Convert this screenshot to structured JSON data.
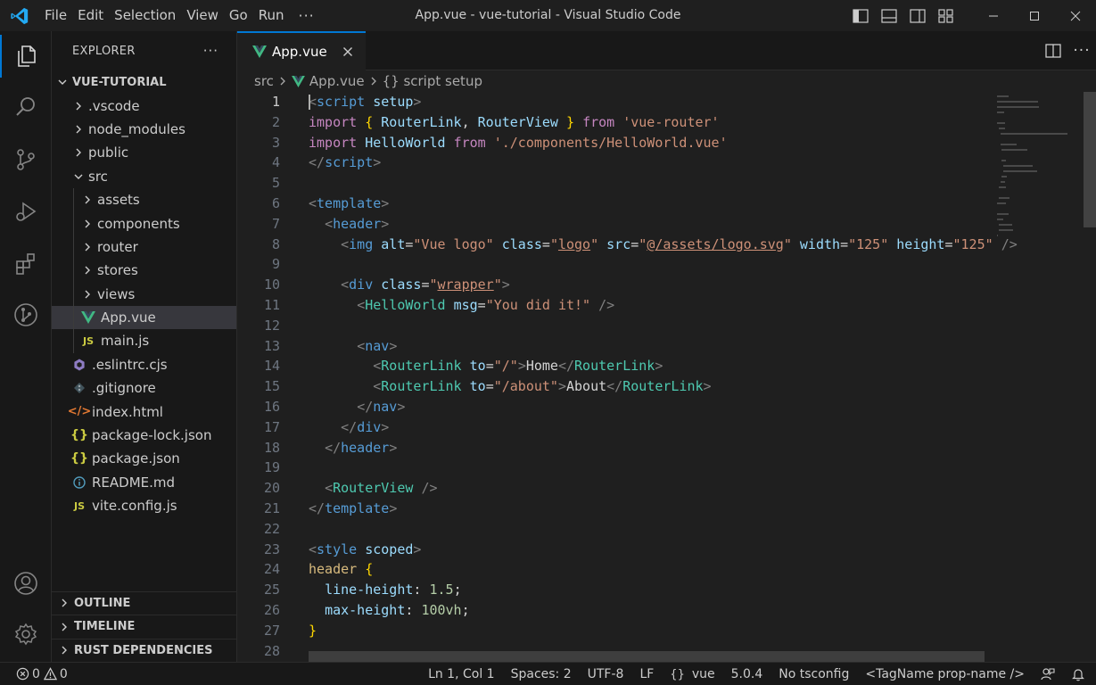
{
  "window": {
    "title": "App.vue - vue-tutorial - Visual Studio Code"
  },
  "menu": [
    "File",
    "Edit",
    "Selection",
    "View",
    "Go",
    "Run",
    "···"
  ],
  "activity_bar": {
    "top": [
      "explorer-icon",
      "search-icon",
      "source-control-icon",
      "run-debug-icon",
      "extensions-icon",
      "git-graph-icon"
    ],
    "bottom": [
      "account-icon",
      "settings-gear-icon"
    ]
  },
  "sidebar": {
    "title": "EXPLORER",
    "more": "···",
    "root": "VUE-TUTORIAL",
    "items": [
      {
        "label": ".vscode",
        "kind": "folder",
        "depth": 1,
        "expanded": false
      },
      {
        "label": "node_modules",
        "kind": "folder",
        "depth": 1,
        "expanded": false
      },
      {
        "label": "public",
        "kind": "folder",
        "depth": 1,
        "expanded": false
      },
      {
        "label": "src",
        "kind": "folder",
        "depth": 1,
        "expanded": true
      },
      {
        "label": "assets",
        "kind": "folder",
        "depth": 2,
        "expanded": false
      },
      {
        "label": "components",
        "kind": "folder",
        "depth": 2,
        "expanded": false
      },
      {
        "label": "router",
        "kind": "folder",
        "depth": 2,
        "expanded": false
      },
      {
        "label": "stores",
        "kind": "folder",
        "depth": 2,
        "expanded": false
      },
      {
        "label": "views",
        "kind": "folder",
        "depth": 2,
        "expanded": false
      },
      {
        "label": "App.vue",
        "kind": "vue",
        "depth": 2,
        "selected": true
      },
      {
        "label": "main.js",
        "kind": "js",
        "depth": 2
      },
      {
        "label": ".eslintrc.cjs",
        "kind": "eslint",
        "depth": 1
      },
      {
        "label": ".gitignore",
        "kind": "git",
        "depth": 1
      },
      {
        "label": "index.html",
        "kind": "html",
        "depth": 1
      },
      {
        "label": "package-lock.json",
        "kind": "json",
        "depth": 1
      },
      {
        "label": "package.json",
        "kind": "json",
        "depth": 1
      },
      {
        "label": "README.md",
        "kind": "info",
        "depth": 1
      },
      {
        "label": "vite.config.js",
        "kind": "js",
        "depth": 1
      }
    ],
    "panels": [
      "OUTLINE",
      "TIMELINE",
      "RUST DEPENDENCIES"
    ]
  },
  "editor": {
    "tab": {
      "label": "App.vue",
      "close": "✕"
    },
    "breadcrumb": [
      "src",
      "App.vue",
      "{} script setup"
    ],
    "current_line": 1,
    "lines": [
      [
        [
          "punc",
          "<"
        ],
        [
          "tag",
          "script"
        ],
        [
          "text",
          " "
        ],
        [
          "attr",
          "setup"
        ],
        [
          "punc",
          ">"
        ]
      ],
      [
        [
          "kw",
          "import"
        ],
        [
          "text",
          " "
        ],
        [
          "brace",
          "{"
        ],
        [
          "text",
          " "
        ],
        [
          "var",
          "RouterLink"
        ],
        [
          "text",
          ", "
        ],
        [
          "var",
          "RouterView"
        ],
        [
          "text",
          " "
        ],
        [
          "brace",
          "}"
        ],
        [
          "text",
          " "
        ],
        [
          "kw",
          "from"
        ],
        [
          "text",
          " "
        ],
        [
          "str",
          "'vue-router'"
        ]
      ],
      [
        [
          "kw",
          "import"
        ],
        [
          "text",
          " "
        ],
        [
          "var",
          "HelloWorld"
        ],
        [
          "text",
          " "
        ],
        [
          "kw",
          "from"
        ],
        [
          "text",
          " "
        ],
        [
          "str",
          "'./components/HelloWorld.vue'"
        ]
      ],
      [
        [
          "punc",
          "</"
        ],
        [
          "tag",
          "script"
        ],
        [
          "punc",
          ">"
        ]
      ],
      [],
      [
        [
          "punc",
          "<"
        ],
        [
          "tag",
          "template"
        ],
        [
          "punc",
          ">"
        ]
      ],
      [
        [
          "text",
          "  "
        ],
        [
          "punc",
          "<"
        ],
        [
          "tag",
          "header"
        ],
        [
          "punc",
          ">"
        ]
      ],
      [
        [
          "text",
          "    "
        ],
        [
          "punc",
          "<"
        ],
        [
          "tag",
          "img"
        ],
        [
          "text",
          " "
        ],
        [
          "attr",
          "alt"
        ],
        [
          "text",
          "="
        ],
        [
          "str",
          "\"Vue logo\""
        ],
        [
          "text",
          " "
        ],
        [
          "attr",
          "class"
        ],
        [
          "text",
          "="
        ],
        [
          "str",
          "\""
        ],
        [
          "strU",
          "logo"
        ],
        [
          "str",
          "\""
        ],
        [
          "text",
          " "
        ],
        [
          "attr",
          "src"
        ],
        [
          "text",
          "="
        ],
        [
          "str",
          "\""
        ],
        [
          "strU",
          "@/assets/logo.svg"
        ],
        [
          "str",
          "\""
        ],
        [
          "text",
          " "
        ],
        [
          "attr",
          "width"
        ],
        [
          "text",
          "="
        ],
        [
          "str",
          "\"125\""
        ],
        [
          "text",
          " "
        ],
        [
          "attr",
          "height"
        ],
        [
          "text",
          "="
        ],
        [
          "str",
          "\"125\""
        ],
        [
          "text",
          " "
        ],
        [
          "punc",
          "/>"
        ]
      ],
      [],
      [
        [
          "text",
          "    "
        ],
        [
          "punc",
          "<"
        ],
        [
          "tag",
          "div"
        ],
        [
          "text",
          " "
        ],
        [
          "attr",
          "class"
        ],
        [
          "text",
          "="
        ],
        [
          "str",
          "\""
        ],
        [
          "strU",
          "wrapper"
        ],
        [
          "str",
          "\""
        ],
        [
          "punc",
          ">"
        ]
      ],
      [
        [
          "text",
          "      "
        ],
        [
          "punc",
          "<"
        ],
        [
          "comp",
          "HelloWorld"
        ],
        [
          "text",
          " "
        ],
        [
          "attr",
          "msg"
        ],
        [
          "text",
          "="
        ],
        [
          "str",
          "\"You did it!\""
        ],
        [
          "text",
          " "
        ],
        [
          "punc",
          "/>"
        ]
      ],
      [],
      [
        [
          "text",
          "      "
        ],
        [
          "punc",
          "<"
        ],
        [
          "tag",
          "nav"
        ],
        [
          "punc",
          ">"
        ]
      ],
      [
        [
          "text",
          "        "
        ],
        [
          "punc",
          "<"
        ],
        [
          "comp",
          "RouterLink"
        ],
        [
          "text",
          " "
        ],
        [
          "attr",
          "to"
        ],
        [
          "text",
          "="
        ],
        [
          "str",
          "\"/\""
        ],
        [
          "punc",
          ">"
        ],
        [
          "text",
          "Home"
        ],
        [
          "punc",
          "</"
        ],
        [
          "comp",
          "RouterLink"
        ],
        [
          "punc",
          ">"
        ]
      ],
      [
        [
          "text",
          "        "
        ],
        [
          "punc",
          "<"
        ],
        [
          "comp",
          "RouterLink"
        ],
        [
          "text",
          " "
        ],
        [
          "attr",
          "to"
        ],
        [
          "text",
          "="
        ],
        [
          "str",
          "\"/about\""
        ],
        [
          "punc",
          ">"
        ],
        [
          "text",
          "About"
        ],
        [
          "punc",
          "</"
        ],
        [
          "comp",
          "RouterLink"
        ],
        [
          "punc",
          ">"
        ]
      ],
      [
        [
          "text",
          "      "
        ],
        [
          "punc",
          "</"
        ],
        [
          "tag",
          "nav"
        ],
        [
          "punc",
          ">"
        ]
      ],
      [
        [
          "text",
          "    "
        ],
        [
          "punc",
          "</"
        ],
        [
          "tag",
          "div"
        ],
        [
          "punc",
          ">"
        ]
      ],
      [
        [
          "text",
          "  "
        ],
        [
          "punc",
          "</"
        ],
        [
          "tag",
          "header"
        ],
        [
          "punc",
          ">"
        ]
      ],
      [],
      [
        [
          "text",
          "  "
        ],
        [
          "punc",
          "<"
        ],
        [
          "comp",
          "RouterView"
        ],
        [
          "text",
          " "
        ],
        [
          "punc",
          "/>"
        ]
      ],
      [
        [
          "punc",
          "</"
        ],
        [
          "tag",
          "template"
        ],
        [
          "punc",
          ">"
        ]
      ],
      [],
      [
        [
          "punc",
          "<"
        ],
        [
          "tag",
          "style"
        ],
        [
          "text",
          " "
        ],
        [
          "attr",
          "scoped"
        ],
        [
          "punc",
          ">"
        ]
      ],
      [
        [
          "sel",
          "header"
        ],
        [
          "text",
          " "
        ],
        [
          "brace",
          "{"
        ]
      ],
      [
        [
          "text",
          "  "
        ],
        [
          "attr",
          "line-height"
        ],
        [
          "text",
          ": "
        ],
        [
          "num",
          "1.5"
        ],
        [
          "text",
          ";"
        ]
      ],
      [
        [
          "text",
          "  "
        ],
        [
          "attr",
          "max-height"
        ],
        [
          "text",
          ": "
        ],
        [
          "num",
          "100vh"
        ],
        [
          "text",
          ";"
        ]
      ],
      [
        [
          "brace",
          "}"
        ]
      ],
      []
    ]
  },
  "status_bar": {
    "errors": "0",
    "warnings": "0",
    "position": "Ln 1, Col 1",
    "spaces": "Spaces: 2",
    "encoding": "UTF-8",
    "eol": "LF",
    "language": "vue",
    "version": "5.0.4",
    "tsconfig": "No tsconfig",
    "tag_format": "<TagName prop-name />"
  },
  "colors": {
    "accent": "#0078d4",
    "vue_green": "#41b883",
    "js_yellow": "#cbcb41",
    "html_orange": "#e37933",
    "eslint_purple": "#8e7cc3",
    "json_yellow": "#cbcb41",
    "info_blue": "#519aba"
  }
}
